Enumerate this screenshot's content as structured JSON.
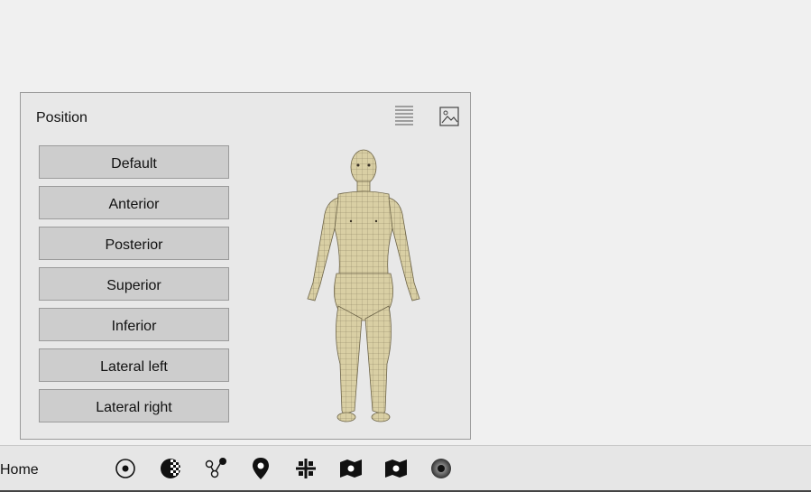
{
  "panel": {
    "title": "Position",
    "icons": [
      "list-view-icon",
      "image-view-icon"
    ],
    "buttons": [
      "Default",
      "Anterior",
      "Posterior",
      "Superior",
      "Inferior",
      "Lateral left",
      "Lateral right"
    ]
  },
  "bottombar": {
    "home_label": "Home",
    "tools": [
      "target-icon",
      "checker-sphere-icon",
      "nodes-icon",
      "map-pin-icon",
      "cross-pin-icon",
      "flag-map-icon",
      "flag-map-icon-2",
      "ring-icon"
    ]
  },
  "colors": {
    "background": "#f0f0f0",
    "panel": "#e8e8e8",
    "button": "#cdcdcd",
    "skin": "#d9cfa4",
    "mesh": "#8a7f60"
  }
}
